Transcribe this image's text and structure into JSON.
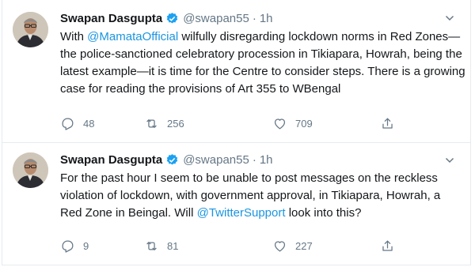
{
  "tweets": [
    {
      "name": "Swapan Dasgupta",
      "handle": "@swapan55",
      "dot": "·",
      "time": "1h",
      "lines": [
        [
          {
            "t": "With "
          },
          {
            "t": "@MamataOfficial",
            "m": true
          },
          {
            "t": " wilfully disregarding lockdown norms in Red Zones—"
          }
        ],
        [
          {
            "t": "the police-sanctioned celebratory procession in Tikiapara, Howrah, being the"
          }
        ],
        [
          {
            "t": "latest example—it is time for the Centre to consider steps. There is a growing"
          }
        ],
        [
          {
            "t": "case for reading the provisions of Art 355 to WBengal"
          }
        ]
      ],
      "replies": "48",
      "retweets": "256",
      "likes": "709"
    },
    {
      "name": "Swapan Dasgupta",
      "handle": "@swapan55",
      "dot": "·",
      "time": "1h",
      "lines": [
        [
          {
            "t": "For the past hour I seem to be unable to post messages on the reckless"
          }
        ],
        [
          {
            "t": "violation of lockdown, with government approval, in Tikiapara, Howrah, a"
          }
        ],
        [
          {
            "t": "Red Zone in Beingal. Will "
          },
          {
            "t": "@TwitterSupport",
            "m": true
          },
          {
            "t": " look into this?"
          }
        ]
      ],
      "replies": "9",
      "retweets": "81",
      "likes": "227"
    }
  ],
  "icons": {
    "verified": "verified-badge-icon",
    "caret": "chevron-down-icon",
    "reply": "reply-icon",
    "retweet": "retweet-icon",
    "like": "heart-icon",
    "share": "share-icon"
  },
  "colors": {
    "text": "#14171a",
    "muted": "#657786",
    "link": "#1b95e0",
    "verified": "#1da1f2",
    "border": "#e6ecf0"
  }
}
